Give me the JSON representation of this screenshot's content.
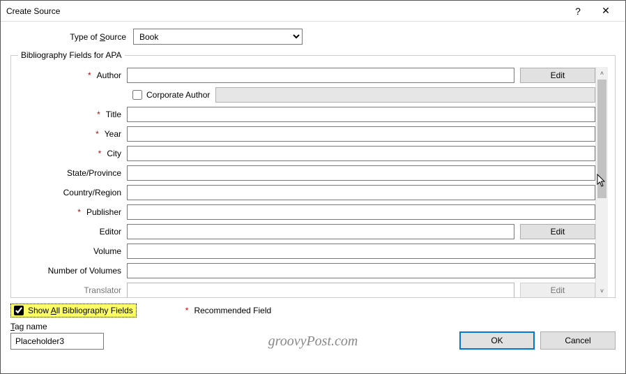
{
  "window": {
    "title": "Create Source",
    "help": "?",
    "close": "✕"
  },
  "sourceType": {
    "label_pre": "Type of ",
    "label_key": "S",
    "label_post": "ource",
    "value": "Book"
  },
  "group": {
    "legend": "Bibliography Fields for APA"
  },
  "fields": [
    {
      "required": true,
      "label": "Author",
      "value": "",
      "edit": "Edit"
    },
    {
      "type": "check",
      "label": "Corporate Author",
      "checked": false
    },
    {
      "required": true,
      "label": "Title",
      "value": ""
    },
    {
      "required": true,
      "label": "Year",
      "value": ""
    },
    {
      "required": true,
      "label": "City",
      "value": ""
    },
    {
      "required": false,
      "label": "State/Province",
      "value": ""
    },
    {
      "required": false,
      "label": "Country/Region",
      "value": ""
    },
    {
      "required": true,
      "label": "Publisher",
      "value": ""
    },
    {
      "required": false,
      "label": "Editor",
      "value": "",
      "edit": "Edit"
    },
    {
      "required": false,
      "label": "Volume",
      "value": ""
    },
    {
      "required": false,
      "label": "Number of Volumes",
      "value": ""
    },
    {
      "required": false,
      "label": "Translator",
      "value": "",
      "edit": "Edit"
    }
  ],
  "scroll": {
    "up": "˄",
    "down": "˅"
  },
  "showAll": {
    "checked": true,
    "label_pre": "Show ",
    "label_key": "A",
    "label_post": "ll Bibliography Fields"
  },
  "recommended": {
    "asterisk": "*",
    "label": "Recommended Field"
  },
  "tag": {
    "label_key": "T",
    "label_post": "ag name",
    "value": "Placeholder3"
  },
  "buttons": {
    "ok": "OK",
    "cancel": "Cancel"
  },
  "watermark": "groovyPost.com"
}
